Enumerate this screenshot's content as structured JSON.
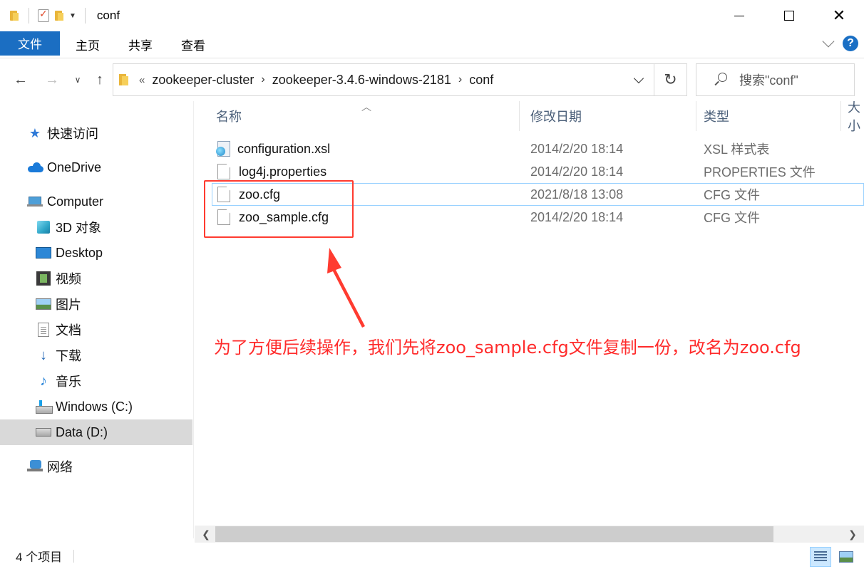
{
  "window": {
    "title": "conf",
    "controls": {
      "minimize": "—",
      "maximize": "☐",
      "close": "✕"
    }
  },
  "ribbon": {
    "tabs": [
      "文件",
      "主页",
      "共享",
      "查看"
    ]
  },
  "address_bar": {
    "overflow": "«",
    "crumbs": [
      "zookeeper-cluster",
      "zookeeper-3.4.6-windows-2181",
      "conf"
    ],
    "search_placeholder": "搜索\"conf\""
  },
  "sidebar": {
    "items": [
      {
        "label": "快速访问",
        "icon": "star-icon"
      },
      {
        "label": "OneDrive",
        "icon": "cloud-icon"
      },
      {
        "label": "Computer",
        "icon": "computer-icon"
      },
      {
        "label": "3D 对象",
        "icon": "3d-objects-icon"
      },
      {
        "label": "Desktop",
        "icon": "desktop-icon"
      },
      {
        "label": "视频",
        "icon": "video-icon"
      },
      {
        "label": "图片",
        "icon": "pictures-icon"
      },
      {
        "label": "文档",
        "icon": "documents-icon"
      },
      {
        "label": "下载",
        "icon": "download-icon"
      },
      {
        "label": "音乐",
        "icon": "music-icon"
      },
      {
        "label": "Windows (C:)",
        "icon": "windows-drive-icon"
      },
      {
        "label": "Data (D:)",
        "icon": "drive-icon",
        "selected": true
      },
      {
        "label": "网络",
        "icon": "network-icon"
      }
    ]
  },
  "file_list": {
    "columns": [
      "名称",
      "修改日期",
      "类型",
      "大小"
    ],
    "rows": [
      {
        "name": "configuration.xsl",
        "date": "2014/2/20 18:14",
        "type": "XSL 样式表",
        "icon": "xsl-file-icon"
      },
      {
        "name": "log4j.properties",
        "date": "2014/2/20 18:14",
        "type": "PROPERTIES 文件",
        "icon": "file-icon"
      },
      {
        "name": "zoo.cfg",
        "date": "2021/8/18 13:08",
        "type": "CFG 文件",
        "icon": "file-icon",
        "hover": true
      },
      {
        "name": "zoo_sample.cfg",
        "date": "2014/2/20 18:14",
        "type": "CFG 文件",
        "icon": "file-icon"
      }
    ]
  },
  "annotation": {
    "text": "为了方便后续操作，我们先将zoo_sample.cfg文件复制一份，改名为zoo.cfg",
    "color": "#ff2b2b"
  },
  "status_bar": {
    "item_count": "4 个项目"
  },
  "colors": {
    "accent": "#1b6ec2",
    "selection": "#d9d9d9",
    "hover_border": "#99d1ff"
  }
}
